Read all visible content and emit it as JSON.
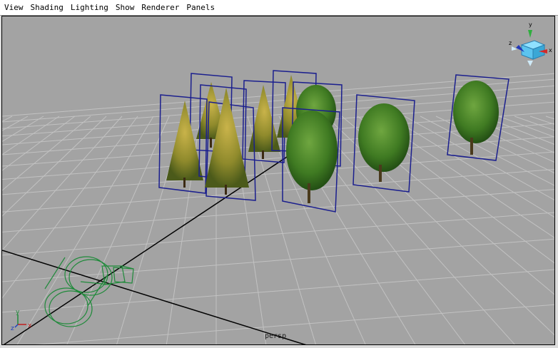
{
  "menubar": {
    "items": [
      "View",
      "Shading",
      "Lighting",
      "Show",
      "Renderer",
      "Panels"
    ]
  },
  "viewport": {
    "camera_name": "persp",
    "background_color": "#a3a3a3",
    "grid_color": "#c2c2c2",
    "axis_color": "#000000",
    "selection_frame_color": "#1b1f8e",
    "camera_wire_color": "#1f8a3a"
  },
  "view_cube": {
    "labels": {
      "x": "x",
      "y": "y",
      "z": "z"
    }
  },
  "axis_indicator": {
    "labels": {
      "x": "x",
      "y": "y",
      "z": "z"
    }
  },
  "objects": {
    "pine_trees": 4,
    "deciduous_trees": 4,
    "cameras": 1
  }
}
